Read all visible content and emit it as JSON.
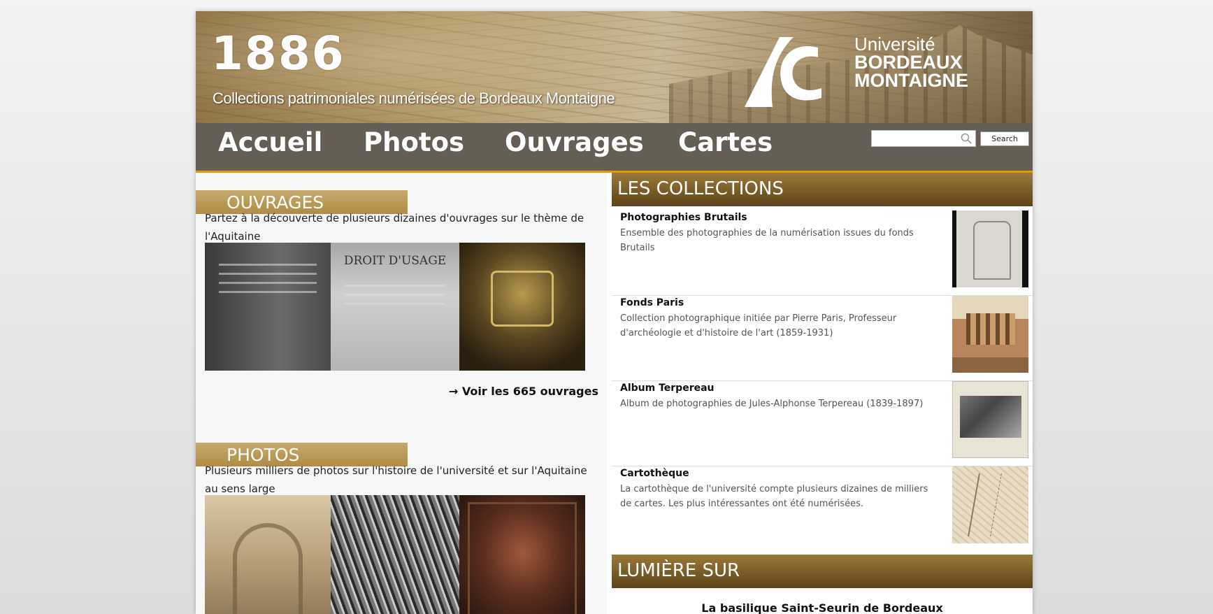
{
  "header": {
    "logo_number": "1886",
    "subtitle": "Collections patrimoniales numérisées de Bordeaux Montaigne",
    "university": {
      "line1": "Université",
      "line2": "BORDEAUX",
      "line3": "MONTAIGNE"
    }
  },
  "nav": {
    "items": [
      "Accueil",
      "Photos",
      "Ouvrages",
      "Cartes"
    ],
    "search_value": "",
    "search_button": "Search"
  },
  "ouvrages": {
    "heading": "OUVRAGES",
    "intro": "Partez à la découverte de plusieurs dizaines d'ouvrages sur le thème de l'Aquitaine",
    "book2_title": "DROIT D'USAGE",
    "link": "→ Voir les 665 ouvrages"
  },
  "photos": {
    "heading": "PHOTOS",
    "intro": "Plusieurs milliers de photos sur l'histoire de l'université et sur l'Aquitaine au sens large"
  },
  "collections": {
    "heading": "LES COLLECTIONS",
    "items": [
      {
        "title": "Photographies Brutails",
        "description": "Ensemble des photographies de la numérisation issues du fonds Brutails"
      },
      {
        "title": "Fonds Paris",
        "description": "Collection photographique initiée par Pierre Paris, Professeur d'archéologie et d'histoire de l'art (1859-1931)"
      },
      {
        "title": "Album Terpereau",
        "description": "Album de photographies de Jules-Alphonse Terpereau (1839-1897)"
      },
      {
        "title": "Cartothèque",
        "description": "La cartothèque de l'université compte plusieurs dizaines de milliers de cartes. Les plus intéressantes ont été numérisées."
      }
    ]
  },
  "lumiere": {
    "heading": "LUMIÈRE SUR",
    "title": "La basilique Saint-Seurin de Bordeaux"
  },
  "colors": {
    "accent_orange": "#e69a00",
    "gold_band": "#b08c45",
    "brown_header": "#5e4219"
  },
  "icons": {
    "search": "search-icon"
  }
}
